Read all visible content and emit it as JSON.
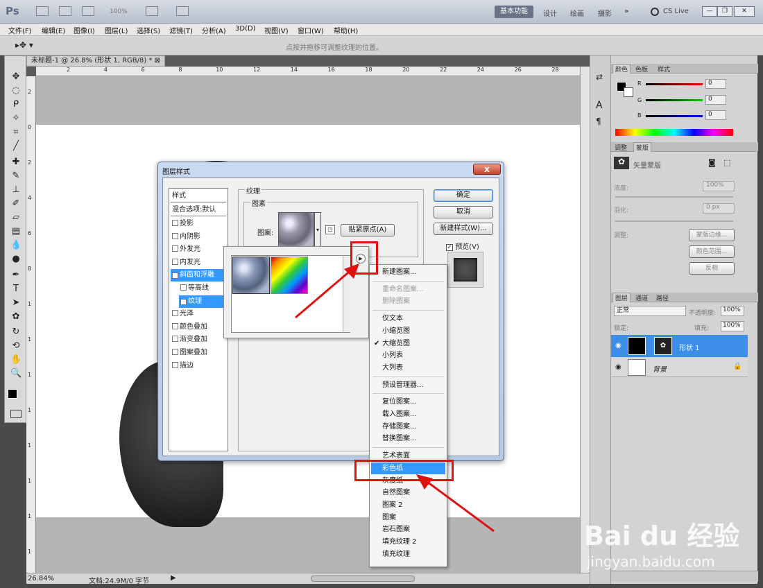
{
  "app": {
    "logo": "Ps",
    "zoom": "100%",
    "workspace_active": "基本功能",
    "workspaces": [
      "设计",
      "绘画",
      "摄影"
    ],
    "cs_live": "CS Live"
  },
  "menu": [
    "文件(F)",
    "编辑(E)",
    "图像(I)",
    "图层(L)",
    "选择(S)",
    "滤镜(T)",
    "分析(A)",
    "3D(D)",
    "视图(V)",
    "窗口(W)",
    "帮助(H)"
  ],
  "options_hint": "点按并拖移可调整纹理的位置。",
  "document": {
    "tab_title": "未标题-1 @ 26.8% (形状 1, RGB/8) *",
    "ruler_top": [
      "2",
      "4",
      "6",
      "8",
      "10",
      "12",
      "14",
      "16",
      "18",
      "20",
      "22",
      "24",
      "26",
      "28"
    ],
    "ruler_left": [
      "2",
      "0",
      "2",
      "4",
      "6",
      "8",
      "1",
      "1",
      "1",
      "1",
      "1",
      "1",
      "1",
      "1"
    ],
    "zoom": "26.84%",
    "doc_info": "文档:24.9M/0 字节"
  },
  "panels": {
    "color_tabs": [
      "颜色",
      "色板",
      "样式"
    ],
    "color_channels": [
      {
        "label": "R",
        "value": "0"
      },
      {
        "label": "G",
        "value": "0"
      },
      {
        "label": "B",
        "value": "0"
      }
    ],
    "adjust_tabs": [
      "调整",
      "蒙版"
    ],
    "mask_label": "矢量蒙版",
    "density_label": "浓度:",
    "density_value": "100%",
    "feather_label": "羽化:",
    "feather_value": "0 px",
    "refine_label": "调整:",
    "mask_buttons": [
      "蒙版边缘...",
      "颜色范围...",
      "反相"
    ],
    "layers_tabs": [
      "图层",
      "通道",
      "路径"
    ],
    "blend_mode": "正常",
    "opacity_label": "不透明度:",
    "opacity_value": "100%",
    "lock_label": "锁定:",
    "fill_label": "填充:",
    "fill_value": "100%",
    "layers": [
      {
        "name": "形状 1"
      },
      {
        "name": "背景"
      }
    ]
  },
  "dialog": {
    "title": "图层样式",
    "close": "x",
    "styles_header": "样式",
    "blend_default": "混合选项:默认",
    "style_items": [
      {
        "label": "投影",
        "checked": false
      },
      {
        "label": "内阴影",
        "checked": false
      },
      {
        "label": "外发光",
        "checked": false
      },
      {
        "label": "内发光",
        "checked": false
      },
      {
        "label": "斜面和浮雕",
        "checked": true
      },
      {
        "label": "等高线",
        "checked": false
      },
      {
        "label": "纹理",
        "checked": true
      },
      {
        "label": "光泽",
        "checked": false
      },
      {
        "label": "颜色叠加",
        "checked": false
      },
      {
        "label": "渐变叠加",
        "checked": false
      },
      {
        "label": "图案叠加",
        "checked": false
      },
      {
        "label": "描边",
        "checked": false
      }
    ],
    "texture_legend": "纹理",
    "elements_legend": "图素",
    "pattern_label": "图案:",
    "snap_button": "贴紧原点(A)",
    "ok": "确定",
    "cancel": "取消",
    "new_style": "新建样式(W)...",
    "preview_label": "预览(V)",
    "preview_checked": true
  },
  "context_menu": {
    "items": [
      {
        "label": "新建图案...",
        "state": "normal"
      },
      {
        "sep": true
      },
      {
        "label": "重命名图案...",
        "state": "disabled"
      },
      {
        "label": "删除图案",
        "state": "disabled"
      },
      {
        "sep": true
      },
      {
        "label": "仅文本",
        "state": "normal"
      },
      {
        "label": "小缩览图",
        "state": "normal"
      },
      {
        "label": "大缩览图",
        "state": "checked"
      },
      {
        "label": "小列表",
        "state": "normal"
      },
      {
        "label": "大列表",
        "state": "normal"
      },
      {
        "sep": true
      },
      {
        "label": "预设管理器...",
        "state": "normal"
      },
      {
        "sep": true
      },
      {
        "label": "复位图案...",
        "state": "normal"
      },
      {
        "label": "载入图案...",
        "state": "normal"
      },
      {
        "label": "存储图案...",
        "state": "normal"
      },
      {
        "label": "替换图案...",
        "state": "normal"
      },
      {
        "sep": true
      },
      {
        "label": "艺术表面",
        "state": "normal"
      },
      {
        "label": "彩色纸",
        "state": "highlighted"
      },
      {
        "label": "灰度纸",
        "state": "normal"
      },
      {
        "label": "自然图案",
        "state": "normal"
      },
      {
        "label": "图案 2",
        "state": "normal"
      },
      {
        "label": "图案",
        "state": "normal"
      },
      {
        "label": "岩石图案",
        "state": "normal"
      },
      {
        "label": "填充纹理 2",
        "state": "normal"
      },
      {
        "label": "填充纹理",
        "state": "normal"
      }
    ]
  },
  "watermark": {
    "brand": "Bai du 经验",
    "url": "jingyan.baidu.com"
  },
  "colors": {
    "accent": "#3399ff",
    "annotation": "#e01010",
    "dialog_frame": "#b5c9e4"
  }
}
